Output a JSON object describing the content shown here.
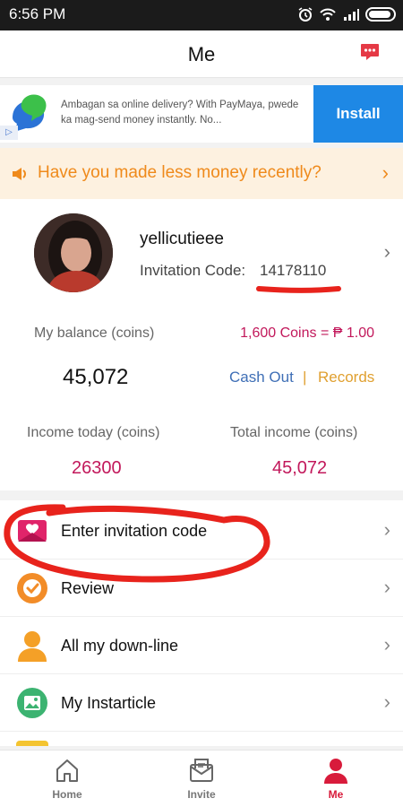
{
  "status_bar": {
    "time": "6:56 PM"
  },
  "header": {
    "title": "Me"
  },
  "ad": {
    "text": "Ambagan sa online delivery? With PayMaya, pwede ka mag-send money instantly. No...",
    "install_label": "Install"
  },
  "notice": {
    "text": "Have you made less money recently?"
  },
  "profile": {
    "username": "yellicutieee",
    "invitation_label": "Invitation Code:",
    "invitation_code": "14178110"
  },
  "wallet": {
    "balance_label": "My balance (coins)",
    "rate": "1,600 Coins = ₱ 1.00",
    "balance": "45,072",
    "cash_out": "Cash Out",
    "separator": "|",
    "records": "Records",
    "income_today_label": "Income today (coins)",
    "total_income_label": "Total income (coins)",
    "income_today": "26300",
    "total_income": "45,072"
  },
  "menu": [
    {
      "label": "Enter invitation code",
      "icon": "envelope-heart-icon"
    },
    {
      "label": "Review",
      "icon": "review-check-icon"
    },
    {
      "label": "All my down-line",
      "icon": "person-icon"
    },
    {
      "label": "My Instarticle",
      "icon": "picture-icon"
    }
  ],
  "bottom_nav": [
    {
      "label": "Home",
      "active": false
    },
    {
      "label": "Invite",
      "active": false
    },
    {
      "label": "Me",
      "active": true
    }
  ],
  "colors": {
    "accent": "#d81b3b",
    "pink_value": "#c2185b",
    "notice_text": "#ef8a1b",
    "install_button": "#1e88e5",
    "annotation_red": "#e8231c"
  }
}
